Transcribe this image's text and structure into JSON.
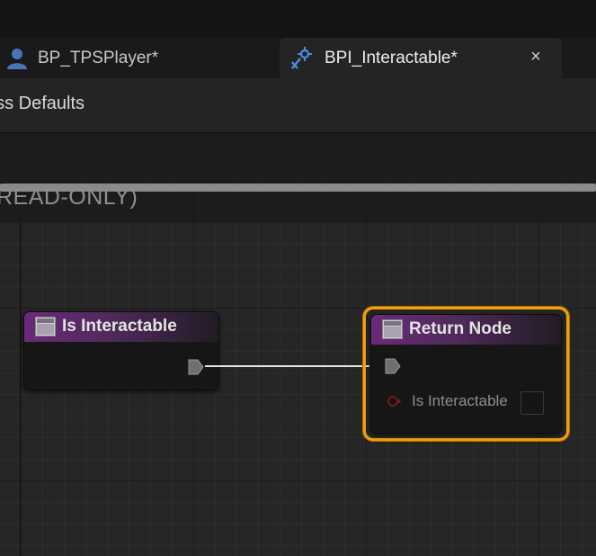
{
  "tabs": [
    {
      "label": "BP_TPSPlayer*",
      "icon": "person-icon",
      "active": false
    },
    {
      "label": "BPI_Interactable*",
      "icon": "interface-icon",
      "active": true,
      "close": "×"
    }
  ],
  "toolbar": {
    "class_defaults": "ass Defaults"
  },
  "graph": {
    "readonly": "READ-ONLY)",
    "nodes": {
      "is_interactable": {
        "title": "Is Interactable"
      },
      "return_node": {
        "title": "Return Node",
        "param_label": "Is Interactable"
      }
    }
  },
  "colors": {
    "accent_tab_icon": "#4a8fe0",
    "function_header": "#6a2a7a",
    "selection_outline": "#f0a10e",
    "bool_pin": "#8a1a1a"
  }
}
